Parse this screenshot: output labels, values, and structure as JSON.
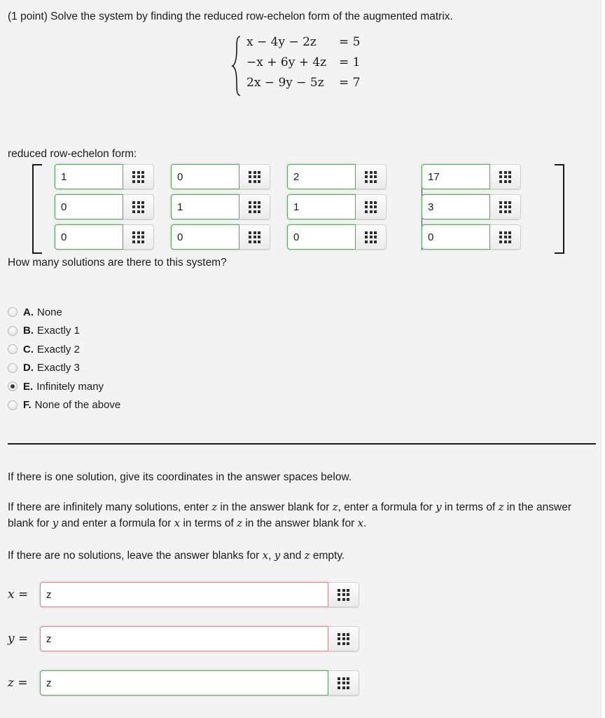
{
  "problem": {
    "prompt": "(1 point) Solve the system by finding the reduced row-echelon form of the augmented matrix.",
    "system": [
      {
        "lhs_terms": "x − 4y − 2z",
        "rhs": "= 5"
      },
      {
        "lhs_terms": "−x + 6y + 4z",
        "rhs": "= 1"
      },
      {
        "lhs_terms": "2x − 9y − 5z",
        "rhs": "= 7"
      }
    ]
  },
  "rref": {
    "label": "reduced row-echelon form:",
    "rows": [
      {
        "coeffs": [
          "1",
          "0",
          "2"
        ],
        "augmented": "17"
      },
      {
        "coeffs": [
          "0",
          "1",
          "1"
        ],
        "augmented": "3"
      },
      {
        "coeffs": [
          "0",
          "0",
          "0"
        ],
        "augmented": "0"
      }
    ],
    "cell_status": "correct",
    "keypad_icon": "keypad-grid-icon"
  },
  "question": {
    "text": "How many solutions are there to this system?",
    "options": [
      {
        "letter": "A.",
        "label": "None",
        "selected": false
      },
      {
        "letter": "B.",
        "label": "Exactly 1",
        "selected": false
      },
      {
        "letter": "C.",
        "label": "Exactly 2",
        "selected": false
      },
      {
        "letter": "D.",
        "label": "Exactly 3",
        "selected": false
      },
      {
        "letter": "E.",
        "label": "Infinitely many",
        "selected": true
      },
      {
        "letter": "F.",
        "label": "None of the above",
        "selected": false
      }
    ]
  },
  "instructions": {
    "p1": "If there is one solution, give its coordinates in the answer spaces below.",
    "p2_a": "If there are infinitely many solutions, enter ",
    "p2_z1": "z",
    "p2_b": " in the answer blank for ",
    "p2_z2": "z",
    "p2_c": ", enter a formula for ",
    "p2_y1": "y",
    "p2_d": " in terms of ",
    "p2_z3": "z",
    "p2_e": " in the answer blank for ",
    "p2_y2": "y",
    "p2_f": " and enter a formula for ",
    "p2_x1": "x",
    "p2_g": " in terms of ",
    "p2_z4": "z",
    "p2_h": " in the answer blank for ",
    "p2_x2": "x",
    "p2_i": ".",
    "p3_a": "If there are no solutions, leave the answer blanks for ",
    "p3_x": "x",
    "p3_b": ", ",
    "p3_y": "y",
    "p3_c": " and ",
    "p3_z": "z",
    "p3_d": " empty."
  },
  "answers": [
    {
      "var": "x",
      "equals": "=",
      "value": "z",
      "status": "incorrect"
    },
    {
      "var": "y",
      "equals": "=",
      "value": "z",
      "status": "incorrect"
    },
    {
      "var": "z",
      "equals": "=",
      "value": "z",
      "status": "correct"
    }
  ],
  "colors": {
    "background": "#f3f3f3",
    "correct_border": "#5aa55a",
    "incorrect_border": "#d98585",
    "text": "#1b1b1b",
    "rule": "#1d1d1d"
  }
}
